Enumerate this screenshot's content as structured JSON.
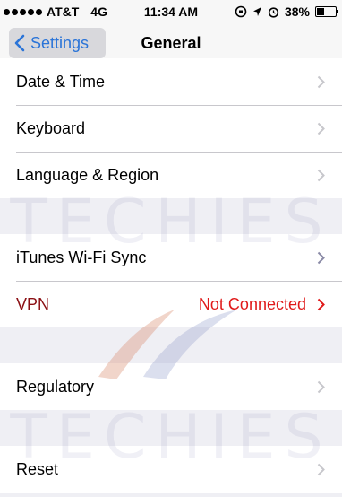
{
  "status_bar": {
    "carrier": "AT&T",
    "network": "4G",
    "time": "11:34 AM",
    "battery_percent": "38%",
    "battery_level": 0.38,
    "signal_dots": 5
  },
  "nav": {
    "back_label": "Settings",
    "title": "General"
  },
  "sections": [
    {
      "rows": [
        {
          "label": "Date & Time"
        },
        {
          "label": "Keyboard"
        },
        {
          "label": "Language & Region"
        }
      ]
    },
    {
      "rows": [
        {
          "label": "iTunes Wi-Fi Sync"
        },
        {
          "label": "VPN",
          "value": "Not Connected"
        }
      ]
    },
    {
      "rows": [
        {
          "label": "Regulatory"
        }
      ]
    },
    {
      "rows": [
        {
          "label": "Reset"
        }
      ]
    }
  ],
  "watermark": "TECHIES",
  "colors": {
    "accent": "#2a74d8",
    "vpn_label": "#8b1014",
    "vpn_value": "#e01a1a",
    "chevron": "#c7c7cc"
  }
}
